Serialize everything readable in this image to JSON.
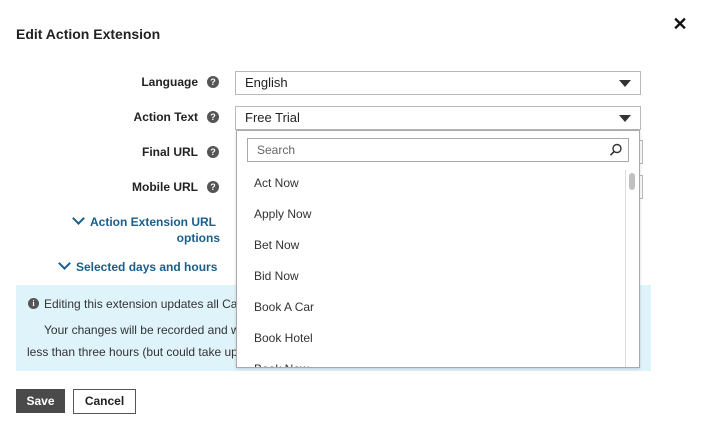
{
  "dialog": {
    "title": "Edit Action Extension",
    "close_icon": "close-icon"
  },
  "form": {
    "language": {
      "label": "Language",
      "value": "English"
    },
    "action_text": {
      "label": "Action Text",
      "value": "Free Trial"
    },
    "final_url": {
      "label": "Final URL"
    },
    "mobile_url": {
      "label": "Mobile URL"
    }
  },
  "links": {
    "url_options_line1": "Action Extension URL",
    "url_options_line2": "options",
    "days_hours": "Selected days and hours"
  },
  "info": {
    "line1": "Editing this extension updates all Ca",
    "line2": "Your changes will be recorded and w",
    "line3": "less than three hours (but could take up"
  },
  "buttons": {
    "save": "Save",
    "cancel": "Cancel"
  },
  "dropdown": {
    "search_placeholder": "Search",
    "options": [
      "Act Now",
      "Apply Now",
      "Bet Now",
      "Bid Now",
      "Book A Car",
      "Book Hotel",
      "Book Now"
    ]
  }
}
